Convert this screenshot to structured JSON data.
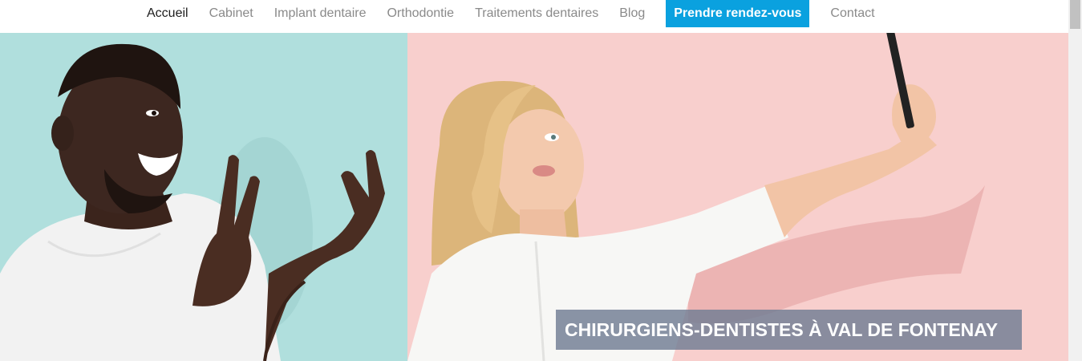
{
  "nav": {
    "items": [
      {
        "label": "Accueil",
        "active": true
      },
      {
        "label": "Cabinet"
      },
      {
        "label": "Implant dentaire"
      },
      {
        "label": "Orthodontie"
      },
      {
        "label": "Traitements dentaires"
      },
      {
        "label": "Blog"
      }
    ],
    "cta_label": "Prendre rendez-vous",
    "contact_label": "Contact"
  },
  "hero": {
    "caption": "CHIRURGIENS-DENTISTES À VAL DE FONTENAY",
    "left_bg": "#b0dfdd",
    "right_bg": "#f8cfcd"
  },
  "colors": {
    "accent": "#0aa1df",
    "nav_text": "#8a8a8a",
    "nav_active": "#1d1d1d"
  }
}
